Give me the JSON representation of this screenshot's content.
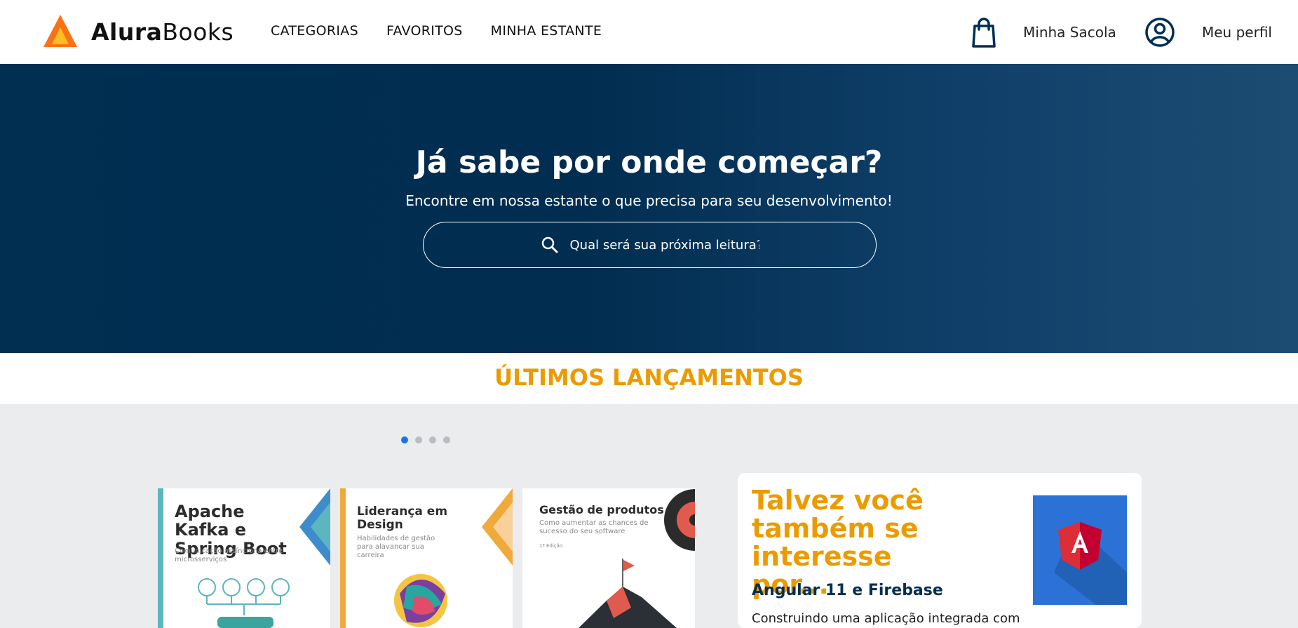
{
  "header": {
    "logo_bold": "Alura",
    "logo_light": "Books",
    "nav": [
      "CATEGORIAS",
      "FAVORITOS",
      "MINHA ESTANTE"
    ],
    "cart_label": "Minha Sacola",
    "profile_label": "Meu perfil"
  },
  "hero": {
    "title": "Já sabe por onde começar?",
    "subtitle": "Encontre em nossa estante o que precisa para seu desenvolvimento!",
    "search_placeholder": "Qual será sua próxima leitura?"
  },
  "releases": {
    "title": "ÚLTIMOS LANÇAMENTOS",
    "carousel_pages": 4,
    "active_page": 1,
    "books": [
      {
        "title": "Apache Kafka e Spring Boot",
        "subtitle": "Comunicação assíncrona entre microsserviços",
        "color": "#5bb6bf"
      },
      {
        "title": "Liderança em Design",
        "subtitle": "Habilidades de gestão para alavancar sua carreira",
        "color": "#f0aa3c"
      },
      {
        "title": "Gestão de produtos",
        "subtitle": "Como aumentar as chances de sucesso do seu software",
        "edition": "1ª Edição",
        "color": "#e05a4e"
      }
    ]
  },
  "recommendation": {
    "title": "Talvez você também se interesse por...",
    "book_title": "Angular 11 e Firebase",
    "description": "Construindo uma aplicação integrada com"
  },
  "colors": {
    "primary": "#002f52",
    "accent": "#eb9b00",
    "carousel_active": "#1875e8"
  }
}
